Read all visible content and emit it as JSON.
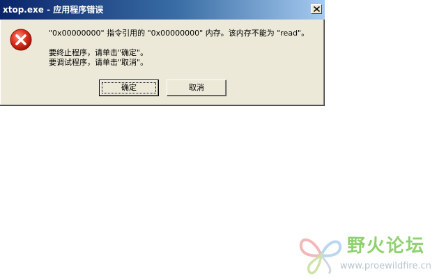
{
  "dialog": {
    "title": "xtop.exe - 应用程序错误",
    "close_label": "×",
    "icon": "error-icon",
    "message_line1": "\"0x00000000\" 指令引用的 \"0x00000000\" 内存。该内存不能为 \"read\"。",
    "message_line2": "要终止程序，请单击\"确定\"。",
    "message_line3": "要调试程序，请单击\"取消\"。",
    "ok_label": "确定",
    "cancel_label": "取消"
  },
  "watermark": {
    "title": "野火论坛",
    "url": "www.proewildfire.cn",
    "icon": "butterfly-logo-icon"
  },
  "colors": {
    "titlebar_start": "#0a246a",
    "titlebar_end": "#a6caf0",
    "dialog_bg": "#ece9d8",
    "error_red": "#d92b1f",
    "watermark_green": "#8fd16e"
  }
}
